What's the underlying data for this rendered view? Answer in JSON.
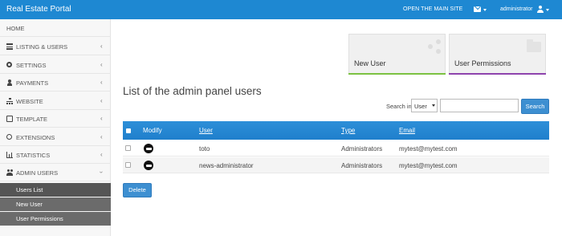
{
  "header": {
    "brand": "Real Estate Portal",
    "main_site_link": "OPEN THE MAIN SITE",
    "messages_icon": "envelope-icon",
    "user_label": "administrator",
    "user_icon": "user-icon"
  },
  "sidebar": {
    "home": "HOME",
    "items": [
      {
        "label": "LISTING & USERS",
        "icon": "list-icon"
      },
      {
        "label": "SETTINGS",
        "icon": "gears-icon"
      },
      {
        "label": "PAYMENTS",
        "icon": "user-icon"
      },
      {
        "label": "WEBSITE",
        "icon": "sitemap-icon"
      },
      {
        "label": "TEMPLATE",
        "icon": "template-icon"
      },
      {
        "label": "EXTENSIONS",
        "icon": "puzzle-icon"
      },
      {
        "label": "STATISTICS",
        "icon": "chart-icon"
      },
      {
        "label": "ADMIN USERS",
        "icon": "users-icon"
      }
    ],
    "sub_items": [
      "Users List",
      "New User",
      "User Permissions"
    ],
    "active_sub_item": "Users List"
  },
  "tiles": [
    {
      "label": "New User",
      "accent": "#7cc242",
      "icon": "share-icon"
    },
    {
      "label": "User Permissions",
      "accent": "#8e44ad",
      "icon": "folder-icon"
    }
  ],
  "main": {
    "heading": "List of the admin panel users",
    "search_label": "Search in",
    "search_field_option": "User",
    "search_value": "",
    "search_button": "Search",
    "delete_button": "Delete"
  },
  "table": {
    "columns": [
      "Modify",
      "User",
      "Type",
      "Email"
    ],
    "rows": [
      {
        "user": "toto",
        "type": "Administrators",
        "email": "mytest@mytest.com"
      },
      {
        "user": "news-administrator",
        "type": "Administrators",
        "email": "mytest@mytest.com"
      }
    ]
  },
  "colors": {
    "topbar": "#1e88d2",
    "table_header": "#2d8fd8",
    "button": "#3d8fd1",
    "sidebar_active": "#555555",
    "sidebar_sub": "#6b6b6b"
  }
}
